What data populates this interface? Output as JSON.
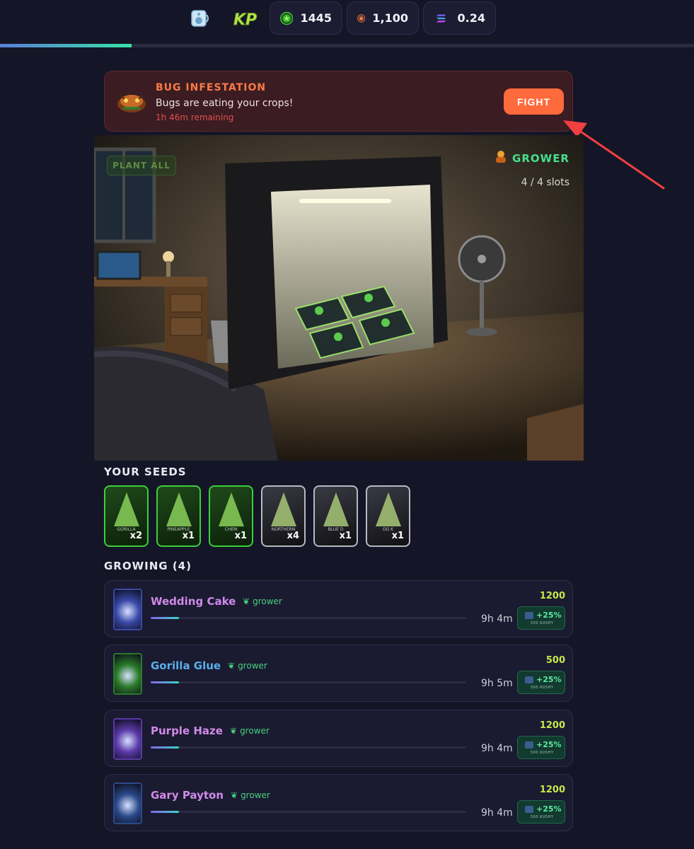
{
  "top_bar": {
    "currency_green": "1445",
    "currency_bronze": "1,100",
    "currency_sol": "0.24",
    "loading_progress": 0.19
  },
  "event_banner": {
    "title": "BUG INFESTATION",
    "description": "Bugs are eating your crops!",
    "time_remaining": "1h 46m remaining",
    "action_label": "FIGHT",
    "accent_color": "#ff6a3d"
  },
  "grow_room": {
    "plant_all_label": "PLANT ALL",
    "role": "GROWER",
    "slots": "4 / 4 slots"
  },
  "seeds": {
    "title": "YOUR SEEDS",
    "items": [
      {
        "name": "GORILLA",
        "qty": "x2",
        "frame": "green"
      },
      {
        "name": "PINEAPPLE",
        "qty": "x1",
        "frame": "green"
      },
      {
        "name": "CHEM",
        "qty": "x1",
        "frame": "green"
      },
      {
        "name": "NORTHERN",
        "qty": "x4",
        "frame": "silver"
      },
      {
        "name": "BLUE D",
        "qty": "x1",
        "frame": "silver"
      },
      {
        "name": "OG K",
        "qty": "x1",
        "frame": "silver"
      }
    ]
  },
  "growing": {
    "title": "GROWING (4)",
    "items": [
      {
        "name": "Wedding Cake",
        "role": "grower",
        "time": "9h 4m",
        "yield": "1200",
        "boost": "+25%",
        "boost_sub": "500 KUSHY",
        "progress": 0.09,
        "name_color": "#d08ae8"
      },
      {
        "name": "Gorilla Glue",
        "role": "grower",
        "time": "9h 5m",
        "yield": "500",
        "boost": "+25%",
        "boost_sub": "500 KUSHY",
        "progress": 0.09,
        "name_color": "#5aaee8"
      },
      {
        "name": "Purple Haze",
        "role": "grower",
        "time": "9h 4m",
        "yield": "1200",
        "boost": "+25%",
        "boost_sub": "500 KUSHY",
        "progress": 0.09,
        "name_color": "#d08ae8"
      },
      {
        "name": "Gary Payton",
        "role": "grower",
        "time": "9h 4m",
        "yield": "1200",
        "boost": "+25%",
        "boost_sub": "500 KUSHY",
        "progress": 0.09,
        "name_color": "#d08ae8"
      }
    ]
  }
}
